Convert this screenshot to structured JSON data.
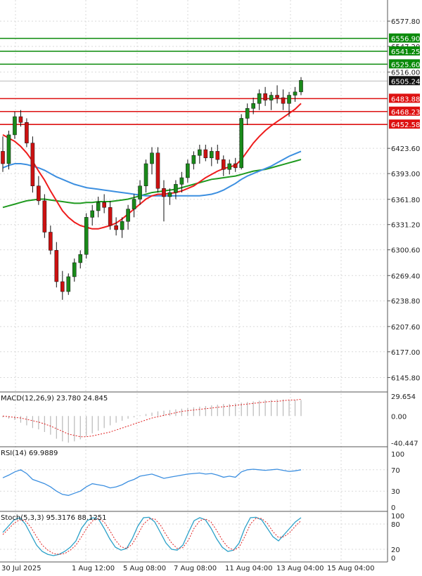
{
  "colors": {
    "bull": "#1a8a1a",
    "bear": "#cc1111",
    "ma_red": "#ee1c1c",
    "ma_blue": "#3c8fe0",
    "ma_green": "#1f9a1f",
    "resistance": "#0a8a0a",
    "support": "#dd1111",
    "grid": "#d9d9d9",
    "last_price_bg": "#111111"
  },
  "chart_data": [
    {
      "panel": "price",
      "type": "candlestick",
      "y_ticks": [
        "6577.80",
        "6547.20",
        "6516.00",
        "6423.60",
        "6393.00",
        "6361.80",
        "6331.20",
        "6300.60",
        "6269.40",
        "6238.80",
        "6207.60",
        "6177.00",
        "6145.80"
      ],
      "ylim": [
        6130,
        6600
      ],
      "last_price": "6505.24",
      "resistance_levels": [
        "6556.90",
        "6541.25",
        "6525.60"
      ],
      "support_levels": [
        "6483.88",
        "6468.23",
        "6452.58"
      ],
      "x_labels": [
        "30 Jul 2025",
        "1 Aug 12:00",
        "5 Aug 08:00",
        "7 Aug 08:00",
        "11 Aug 04:00",
        "13 Aug 04:00",
        "15 Aug 04:00"
      ],
      "candles": [
        [
          6420,
          6438,
          6395,
          6405
        ],
        [
          6405,
          6445,
          6398,
          6440
        ],
        [
          6440,
          6468,
          6435,
          6462
        ],
        [
          6462,
          6470,
          6450,
          6455
        ],
        [
          6455,
          6460,
          6425,
          6430
        ],
        [
          6430,
          6438,
          6370,
          6378
        ],
        [
          6378,
          6390,
          6355,
          6360
        ],
        [
          6360,
          6368,
          6315,
          6322
        ],
        [
          6322,
          6330,
          6295,
          6300
        ],
        [
          6300,
          6310,
          6255,
          6262
        ],
        [
          6262,
          6275,
          6240,
          6250
        ],
        [
          6250,
          6272,
          6246,
          6268
        ],
        [
          6268,
          6290,
          6262,
          6285
        ],
        [
          6285,
          6300,
          6278,
          6295
        ],
        [
          6295,
          6345,
          6290,
          6340
        ],
        [
          6340,
          6355,
          6330,
          6348
        ],
        [
          6348,
          6365,
          6340,
          6358
        ],
        [
          6358,
          6368,
          6345,
          6352
        ],
        [
          6352,
          6360,
          6325,
          6330
        ],
        [
          6330,
          6340,
          6318,
          6325
        ],
        [
          6325,
          6340,
          6315,
          6335
        ],
        [
          6335,
          6355,
          6325,
          6350
        ],
        [
          6350,
          6368,
          6340,
          6362
        ],
        [
          6362,
          6385,
          6355,
          6378
        ],
        [
          6378,
          6410,
          6370,
          6405
        ],
        [
          6405,
          6425,
          6392,
          6418
        ],
        [
          6418,
          6425,
          6370,
          6375
        ],
        [
          6375,
          6385,
          6335,
          6365
        ],
        [
          6365,
          6375,
          6355,
          6370
        ],
        [
          6370,
          6385,
          6362,
          6380
        ],
        [
          6380,
          6395,
          6370,
          6388
        ],
        [
          6388,
          6410,
          6382,
          6405
        ],
        [
          6405,
          6420,
          6398,
          6415
        ],
        [
          6415,
          6428,
          6405,
          6422
        ],
        [
          6422,
          6428,
          6408,
          6412
        ],
        [
          6412,
          6425,
          6402,
          6420
        ],
        [
          6420,
          6428,
          6405,
          6410
        ],
        [
          6410,
          6415,
          6390,
          6398
        ],
        [
          6398,
          6410,
          6392,
          6405
        ],
        [
          6405,
          6412,
          6395,
          6400
        ],
        [
          6400,
          6465,
          6398,
          6460
        ],
        [
          6460,
          6478,
          6452,
          6472
        ],
        [
          6472,
          6485,
          6465,
          6478
        ],
        [
          6478,
          6495,
          6470,
          6490
        ],
        [
          6490,
          6498,
          6475,
          6482
        ],
        [
          6482,
          6492,
          6470,
          6488
        ],
        [
          6488,
          6500,
          6478,
          6485
        ],
        [
          6485,
          6495,
          6470,
          6478
        ],
        [
          6478,
          6492,
          6462,
          6488
        ],
        [
          6488,
          6498,
          6480,
          6492
        ],
        [
          6492,
          6510,
          6488,
          6506
        ]
      ],
      "ma_red": [
        6440,
        6436,
        6432,
        6426,
        6418,
        6408,
        6396,
        6385,
        6372,
        6360,
        6348,
        6340,
        6334,
        6330,
        6328,
        6326,
        6326,
        6328,
        6330,
        6333,
        6338,
        6344,
        6350,
        6356,
        6362,
        6366,
        6368,
        6368,
        6369,
        6370,
        6372,
        6375,
        6378,
        6383,
        6388,
        6392,
        6396,
        6399,
        6401,
        6403,
        6410,
        6420,
        6430,
        6438,
        6445,
        6451,
        6456,
        6461,
        6466,
        6471,
        6478
      ],
      "ma_blue": [
        6400,
        6403,
        6405,
        6405,
        6404,
        6402,
        6400,
        6397,
        6393,
        6389,
        6386,
        6383,
        6380,
        6378,
        6376,
        6375,
        6374,
        6373,
        6372,
        6371,
        6370,
        6369,
        6368,
        6367,
        6366,
        6366,
        6366,
        6366,
        6366,
        6366,
        6366,
        6366,
        6366,
        6366,
        6367,
        6368,
        6370,
        6373,
        6377,
        6381,
        6386,
        6390,
        6393,
        6396,
        6399,
        6402,
        6406,
        6410,
        6414,
        6417,
        6420
      ],
      "ma_green": [
        6352,
        6354,
        6356,
        6358,
        6360,
        6361,
        6362,
        6362,
        6361,
        6360,
        6359,
        6358,
        6357,
        6357,
        6358,
        6358,
        6359,
        6359,
        6359,
        6360,
        6361,
        6362,
        6364,
        6366,
        6368,
        6370,
        6371,
        6372,
        6373,
        6374,
        6376,
        6378,
        6380,
        6382,
        6384,
        6386,
        6387,
        6388,
        6389,
        6390,
        6392,
        6394,
        6396,
        6397,
        6398,
        6400,
        6402,
        6404,
        6406,
        6408,
        6410
      ]
    },
    {
      "panel": "macd",
      "type": "histogram+line",
      "title": "MACD(12,26,9) 23.780 24.845",
      "y_ticks": [
        "29.654",
        "0.00",
        "-40.447"
      ],
      "ylim": [
        -44,
        34
      ],
      "histogram": [
        -2,
        -4,
        -6,
        -10,
        -14,
        -18,
        -20,
        -24,
        -28,
        -34,
        -38,
        -40,
        -38,
        -35,
        -30,
        -26,
        -22,
        -18,
        -14,
        -10,
        -7,
        -4,
        -2,
        1,
        3,
        5,
        7,
        8,
        9,
        10,
        11,
        12,
        13,
        14,
        15,
        16,
        17,
        18,
        18,
        19,
        20,
        21,
        22,
        23,
        24,
        24,
        25,
        25,
        24,
        24,
        24
      ],
      "signal": [
        0,
        -1,
        -2,
        -3,
        -5,
        -7,
        -9,
        -12,
        -15,
        -19,
        -23,
        -27,
        -29,
        -31,
        -31,
        -30,
        -28,
        -26,
        -24,
        -21,
        -18,
        -15,
        -12,
        -9,
        -6,
        -3,
        -1,
        1,
        3,
        5,
        7,
        8,
        9,
        10,
        11,
        12,
        13,
        14,
        15,
        16,
        17,
        18,
        19,
        20,
        21,
        22,
        22,
        23,
        24,
        24,
        25
      ]
    },
    {
      "panel": "rsi",
      "type": "line",
      "title": "RSI(14) 69.9889",
      "y_ticks": [
        "100",
        "70",
        "30",
        "0"
      ],
      "ylim": [
        0,
        100
      ],
      "values": [
        55,
        60,
        66,
        70,
        63,
        52,
        48,
        44,
        38,
        30,
        24,
        22,
        26,
        30,
        38,
        44,
        42,
        40,
        36,
        38,
        42,
        48,
        52,
        58,
        60,
        62,
        58,
        54,
        56,
        58,
        60,
        62,
        63,
        64,
        62,
        63,
        60,
        56,
        58,
        56,
        66,
        70,
        71,
        70,
        69,
        70,
        71,
        69,
        67,
        68,
        70
      ]
    },
    {
      "panel": "stoch",
      "type": "line",
      "title": "Stoch(5,3,3) 95.3176 88.1251",
      "y_ticks": [
        "100",
        "80",
        "20",
        "0"
      ],
      "ylim": [
        0,
        100
      ],
      "k": [
        60,
        75,
        90,
        95,
        80,
        55,
        30,
        15,
        8,
        5,
        8,
        15,
        25,
        40,
        70,
        88,
        95,
        92,
        70,
        45,
        25,
        18,
        22,
        45,
        75,
        95,
        96,
        85,
        60,
        35,
        20,
        18,
        30,
        60,
        88,
        95,
        90,
        70,
        45,
        25,
        15,
        18,
        35,
        70,
        95,
        96,
        90,
        70,
        50,
        40,
        55,
        70,
        85,
        95
      ],
      "d": [
        55,
        68,
        82,
        90,
        88,
        72,
        50,
        30,
        18,
        10,
        8,
        10,
        18,
        30,
        50,
        72,
        88,
        93,
        85,
        65,
        42,
        26,
        22,
        32,
        55,
        80,
        92,
        92,
        78,
        55,
        35,
        22,
        24,
        42,
        70,
        88,
        92,
        85,
        65,
        42,
        25,
        18,
        25,
        50,
        80,
        94,
        93,
        82,
        62,
        48,
        50,
        60,
        75,
        88
      ]
    }
  ]
}
